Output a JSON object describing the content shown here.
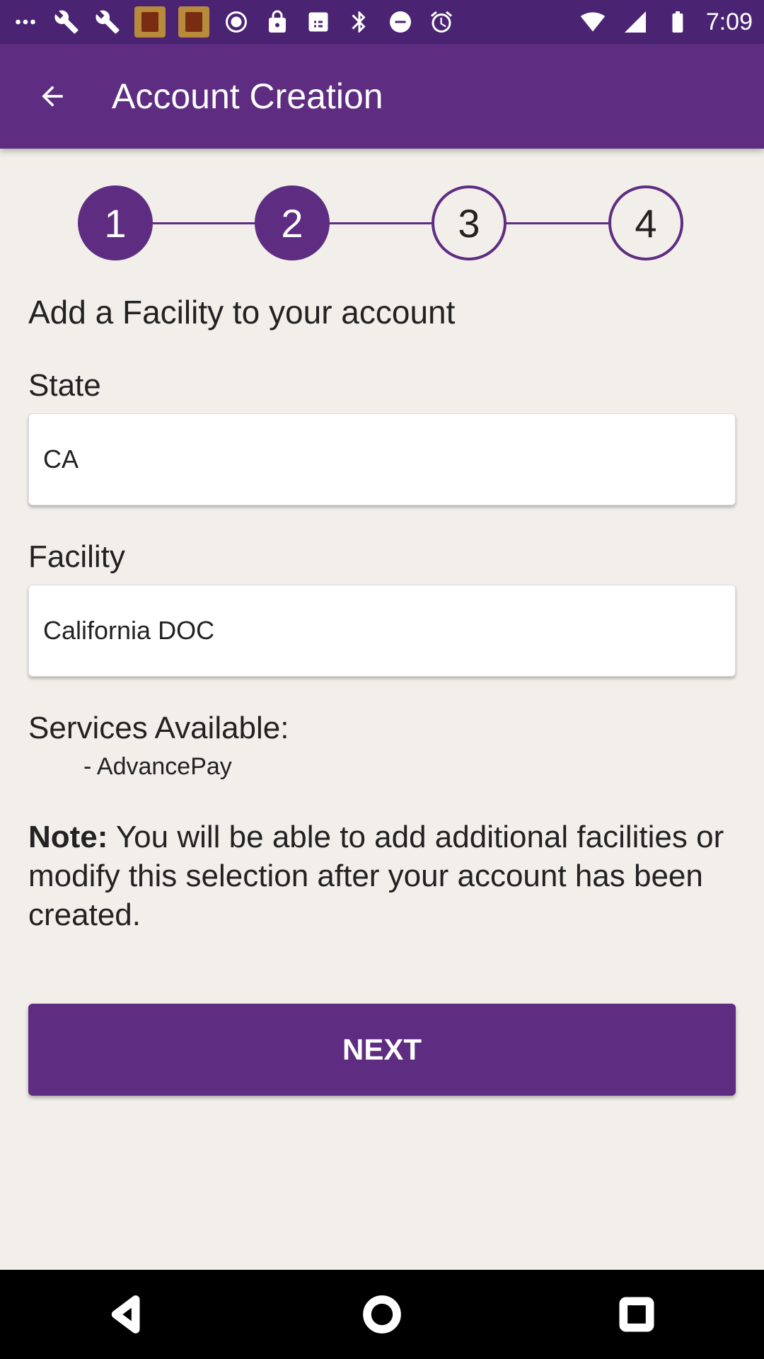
{
  "status_bar": {
    "time": "7:09",
    "left_icons": [
      "more-horiz-icon",
      "wrench-icon",
      "wrench-icon",
      "app-topics-icon",
      "app-topics-icon",
      "record-icon",
      "lock-icon",
      "sim-icon",
      "bluetooth-icon",
      "do-not-disturb-icon",
      "alarm-icon"
    ],
    "right_icons": [
      "wifi-icon",
      "signal-icon",
      "battery-icon"
    ]
  },
  "app_bar": {
    "title": "Account Creation"
  },
  "stepper": {
    "steps": [
      {
        "label": "1",
        "state": "done"
      },
      {
        "label": "2",
        "state": "done"
      },
      {
        "label": "3",
        "state": "todo"
      },
      {
        "label": "4",
        "state": "todo"
      }
    ],
    "accent": "#5e2d82"
  },
  "form": {
    "heading": "Add a Facility to your account",
    "state_label": "State",
    "state_value": "CA",
    "facility_label": "Facility",
    "facility_value": "California DOC",
    "services_label": "Services Available:",
    "services": [
      "- AdvancePay"
    ],
    "note_bold": "Note:",
    "note_text": " You will be able to add additional facilities or modify this selection after your account has been created.",
    "next_label": "NEXT"
  },
  "colors": {
    "primary": "#5e2d82",
    "status_bar": "#4a2472",
    "background": "#f2efea"
  }
}
